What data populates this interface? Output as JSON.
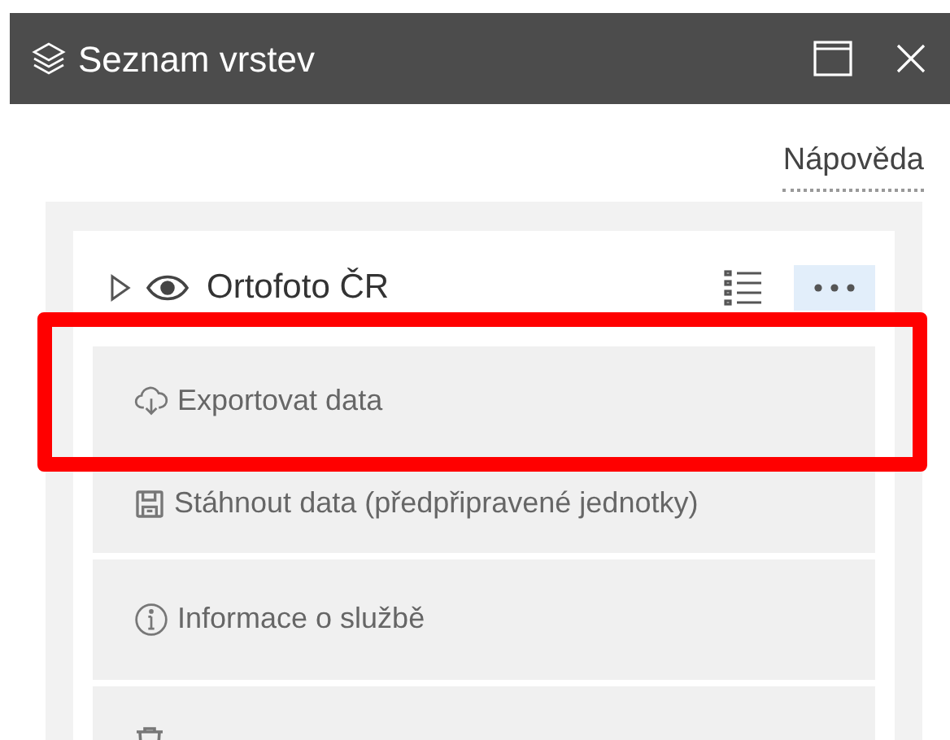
{
  "window": {
    "title": "Seznam vrstev"
  },
  "help_link": "Nápověda",
  "layer": {
    "name": "Ortofoto ČR",
    "expanded": false,
    "visible": true,
    "menu_open": true
  },
  "menu_items": [
    {
      "label": "Exportovat data",
      "highlighted": true
    },
    {
      "label": "Stáhnout data (předpřipravené jednotky)",
      "highlighted": false
    },
    {
      "label": "Informace o službě",
      "highlighted": false
    }
  ]
}
